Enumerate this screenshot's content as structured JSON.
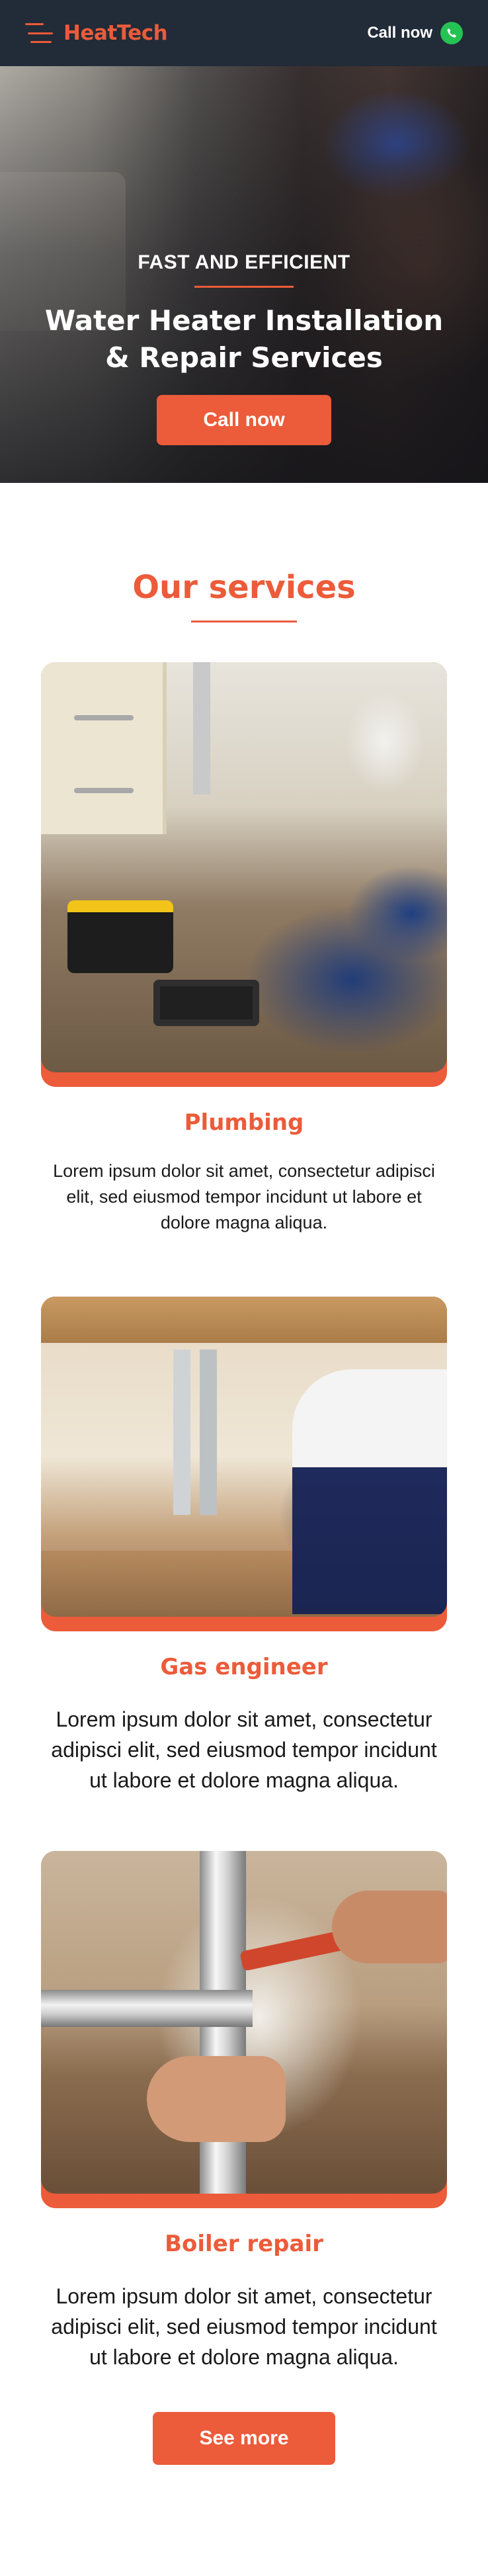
{
  "header": {
    "logo": "HeatTech",
    "menu_icon": "hamburger-menu-icon",
    "call_label": "Call now",
    "call_icon": "whatsapp-phone-icon",
    "brand_color": "#ec5b3a",
    "bar_color": "#222b38"
  },
  "hero": {
    "eyebrow": "FAST AND EFFICIENT",
    "title_line1": "Water Heater Installation",
    "title_line2": "& Repair Services",
    "cta_label": "Call now"
  },
  "services": {
    "title": "Our services",
    "items": [
      {
        "title": "Plumbing",
        "text": "Lorem ipsum dolor sit amet, consectetur adipisci elit, sed eiusmod tempor incidunt ut labore et dolore magna aliqua."
      },
      {
        "title": "Gas engineer",
        "text": "Lorem ipsum dolor sit amet, consectetur adipisci elit, sed eiusmod tempor incidunt ut labore et dolore magna aliqua."
      },
      {
        "title": "Boiler repair",
        "text": "Lorem ipsum dolor sit amet, consectetur adipisci elit, sed eiusmod tempor incidunt ut labore et dolore magna aliqua."
      }
    ],
    "more_label": "See more"
  }
}
